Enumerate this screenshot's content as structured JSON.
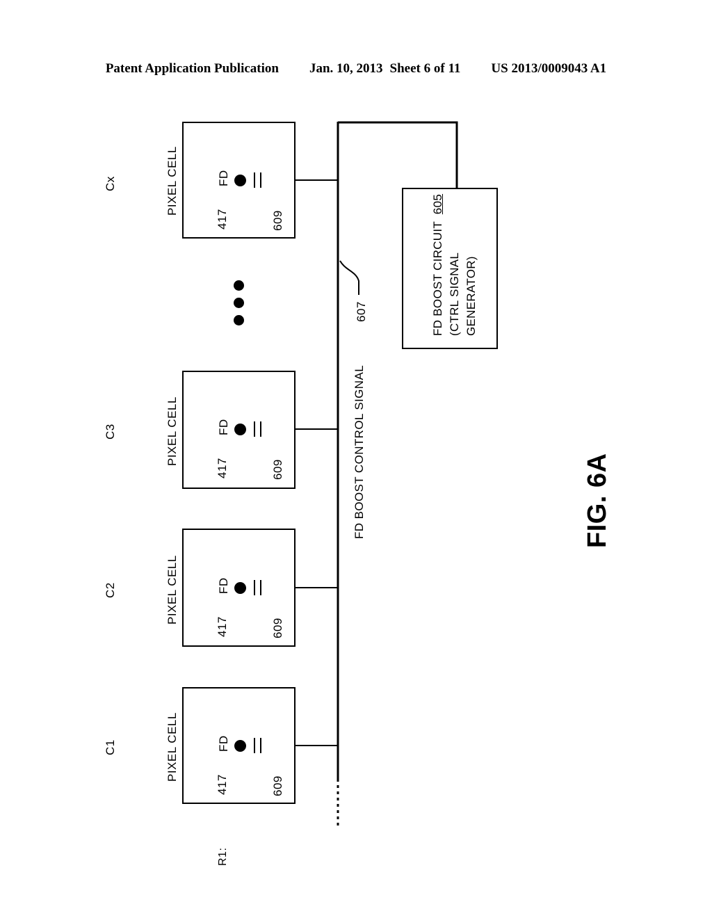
{
  "header": {
    "publication": "Patent Application Publication",
    "date": "Jan. 10, 2013",
    "sheet": "Sheet 6 of 11",
    "number": "US 2013/0009043 A1"
  },
  "figure": {
    "label": "FIG. 6A",
    "row_label": "R1:",
    "bus_label": "FD BOOST CONTROL SIGNAL",
    "bus_ref": "607",
    "ellipsis": "•••"
  },
  "boost_circuit": {
    "line1_text": "FD BOOST CIRCUIT",
    "line1_ref": "605",
    "line2": "(CTRL SIGNAL",
    "line3": "GENERATOR)"
  },
  "columns": [
    {
      "id": "c1",
      "column_label": "C1",
      "cell_label": "PIXEL CELL",
      "node_label": "FD",
      "node_ref": "417",
      "cap_ref": "609"
    },
    {
      "id": "c2",
      "column_label": "C2",
      "cell_label": "PIXEL CELL",
      "node_label": "FD",
      "node_ref": "417",
      "cap_ref": "609"
    },
    {
      "id": "c3",
      "column_label": "C3",
      "cell_label": "PIXEL CELL",
      "node_label": "FD",
      "node_ref": "417",
      "cap_ref": "609"
    },
    {
      "id": "cx",
      "column_label": "Cx",
      "cell_label": "PIXEL CELL",
      "node_label": "FD",
      "node_ref": "417",
      "cap_ref": "609"
    }
  ],
  "colors": {
    "ink": "#000000",
    "paper": "#ffffff"
  }
}
